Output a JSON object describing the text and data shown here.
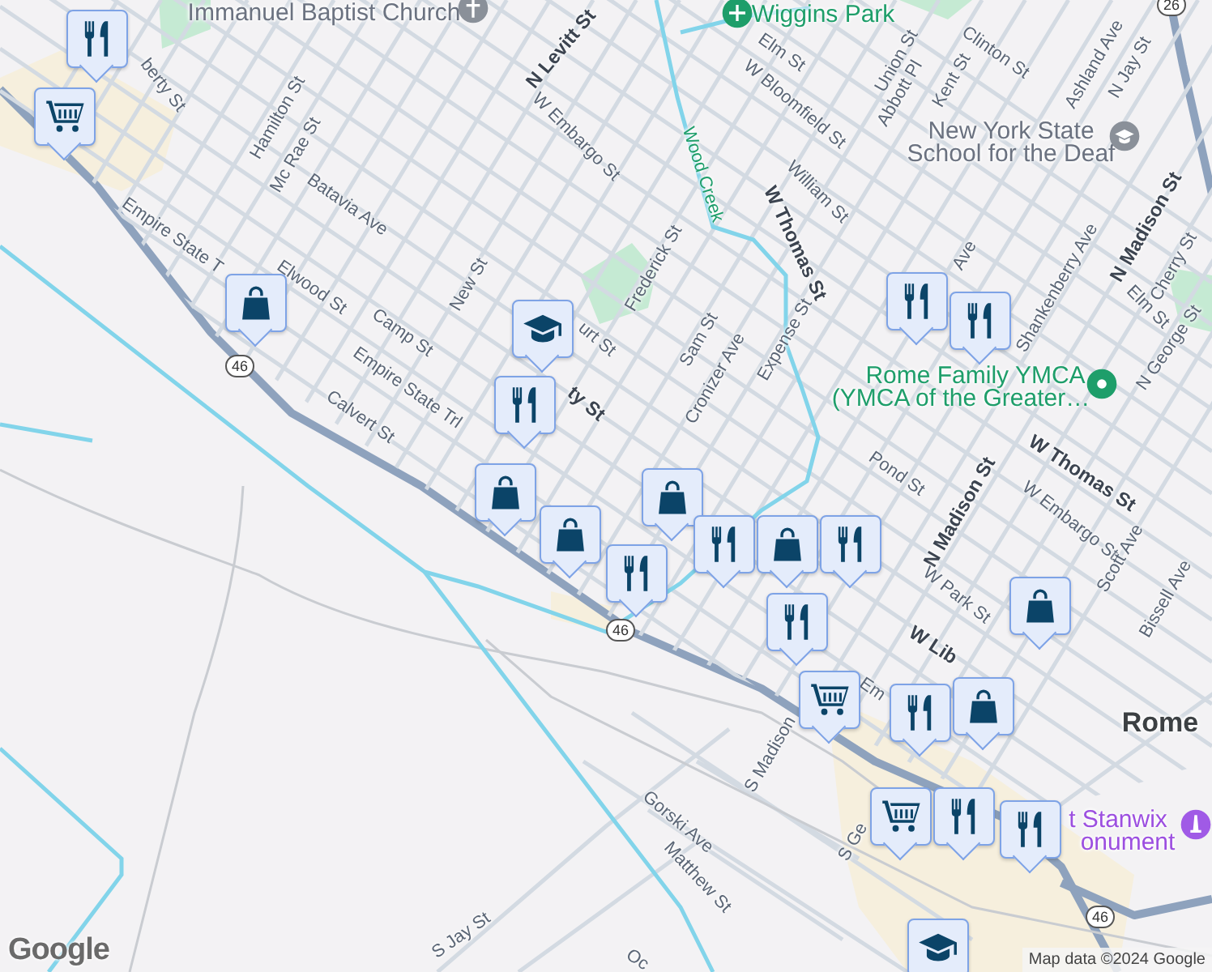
{
  "map": {
    "labels": [
      {
        "text": "Immanuel Baptist Church",
        "kind": "poi"
      },
      {
        "text": "berty St",
        "kind": "street"
      },
      {
        "text": "N Levitt St",
        "kind": "major"
      },
      {
        "text": "Hamilton St",
        "kind": "street"
      },
      {
        "text": "Mc Rae St",
        "kind": "street"
      },
      {
        "text": "W Embargo St",
        "kind": "street"
      },
      {
        "text": "Batavia Ave",
        "kind": "street"
      },
      {
        "text": "Empire State T",
        "kind": "street"
      },
      {
        "text": "Elwood St",
        "kind": "street"
      },
      {
        "text": "New St",
        "kind": "street"
      },
      {
        "text": "Camp St",
        "kind": "street"
      },
      {
        "text": "Empire State Trl",
        "kind": "street"
      },
      {
        "text": "Calvert St",
        "kind": "street"
      },
      {
        "text": "urt St",
        "kind": "street"
      },
      {
        "text": "ty St",
        "kind": "major"
      },
      {
        "text": "Frederick St",
        "kind": "street"
      },
      {
        "text": "Sam St",
        "kind": "street"
      },
      {
        "text": "Cronizer Ave",
        "kind": "street"
      },
      {
        "text": "Expense St",
        "kind": "street"
      },
      {
        "text": "W Thomas St",
        "kind": "major"
      },
      {
        "text": "Wood Creek",
        "kind": "water"
      },
      {
        "text": "Wiggins Park",
        "kind": "park"
      },
      {
        "text": "Elm St",
        "kind": "street"
      },
      {
        "text": "W Bloomfield St",
        "kind": "street"
      },
      {
        "text": "Union St",
        "kind": "street"
      },
      {
        "text": "Abbott Pl",
        "kind": "street"
      },
      {
        "text": "Kent St",
        "kind": "street"
      },
      {
        "text": "Clinton St",
        "kind": "street"
      },
      {
        "text": "Ashland Ave",
        "kind": "street"
      },
      {
        "text": "N Jay St",
        "kind": "street"
      },
      {
        "text": "New York State",
        "kind": "poi"
      },
      {
        "text": "School for the Deaf",
        "kind": "poi"
      },
      {
        "text": "William St",
        "kind": "street"
      },
      {
        "text": "Ave",
        "kind": "street"
      },
      {
        "text": "Shankenberry Ave",
        "kind": "street"
      },
      {
        "text": "N Madison St",
        "kind": "major"
      },
      {
        "text": "Elm St",
        "kind": "street"
      },
      {
        "text": "Cherry St",
        "kind": "street"
      },
      {
        "text": "N George St",
        "kind": "street"
      },
      {
        "text": "Rome Family YMCA",
        "kind": "park"
      },
      {
        "text": "(YMCA of the Greater…",
        "kind": "park"
      },
      {
        "text": "W Thomas St",
        "kind": "major"
      },
      {
        "text": "Pond St",
        "kind": "street"
      },
      {
        "text": "N Madison St",
        "kind": "major"
      },
      {
        "text": "W Embargo St",
        "kind": "street"
      },
      {
        "text": "Scott Ave",
        "kind": "street"
      },
      {
        "text": "Bissell Ave",
        "kind": "street"
      },
      {
        "text": "W Park St",
        "kind": "street"
      },
      {
        "text": "W Lib",
        "kind": "major"
      },
      {
        "text": "Rome",
        "kind": "place"
      },
      {
        "text": "Em",
        "kind": "street"
      },
      {
        "text": "S Madison",
        "kind": "street"
      },
      {
        "text": "Gorski Ave",
        "kind": "street"
      },
      {
        "text": "Matthew St",
        "kind": "street"
      },
      {
        "text": "S Ge",
        "kind": "street"
      },
      {
        "text": "t Stanwix",
        "kind": "monument"
      },
      {
        "text": "onument",
        "kind": "monument"
      },
      {
        "text": "S Jay St",
        "kind": "street"
      },
      {
        "text": "Oc",
        "kind": "street"
      }
    ],
    "shields": [
      "46",
      "46",
      "46",
      "26"
    ],
    "poi_icons": [
      {
        "kind": "church"
      },
      {
        "kind": "park"
      },
      {
        "kind": "school"
      },
      {
        "kind": "ymca"
      },
      {
        "kind": "monument"
      }
    ],
    "markers": [
      {
        "kind": "food"
      },
      {
        "kind": "cart"
      },
      {
        "kind": "bag"
      },
      {
        "kind": "school"
      },
      {
        "kind": "food"
      },
      {
        "kind": "bag"
      },
      {
        "kind": "bag"
      },
      {
        "kind": "bag"
      },
      {
        "kind": "food"
      },
      {
        "kind": "food"
      },
      {
        "kind": "bag"
      },
      {
        "kind": "food"
      },
      {
        "kind": "food"
      },
      {
        "kind": "cart"
      },
      {
        "kind": "food"
      },
      {
        "kind": "food"
      },
      {
        "kind": "bag"
      },
      {
        "kind": "food"
      },
      {
        "kind": "bag"
      },
      {
        "kind": "cart"
      },
      {
        "kind": "food"
      },
      {
        "kind": "food"
      },
      {
        "kind": "school"
      }
    ]
  },
  "logo": "Google",
  "attribution": "Map data ©2024 Google"
}
